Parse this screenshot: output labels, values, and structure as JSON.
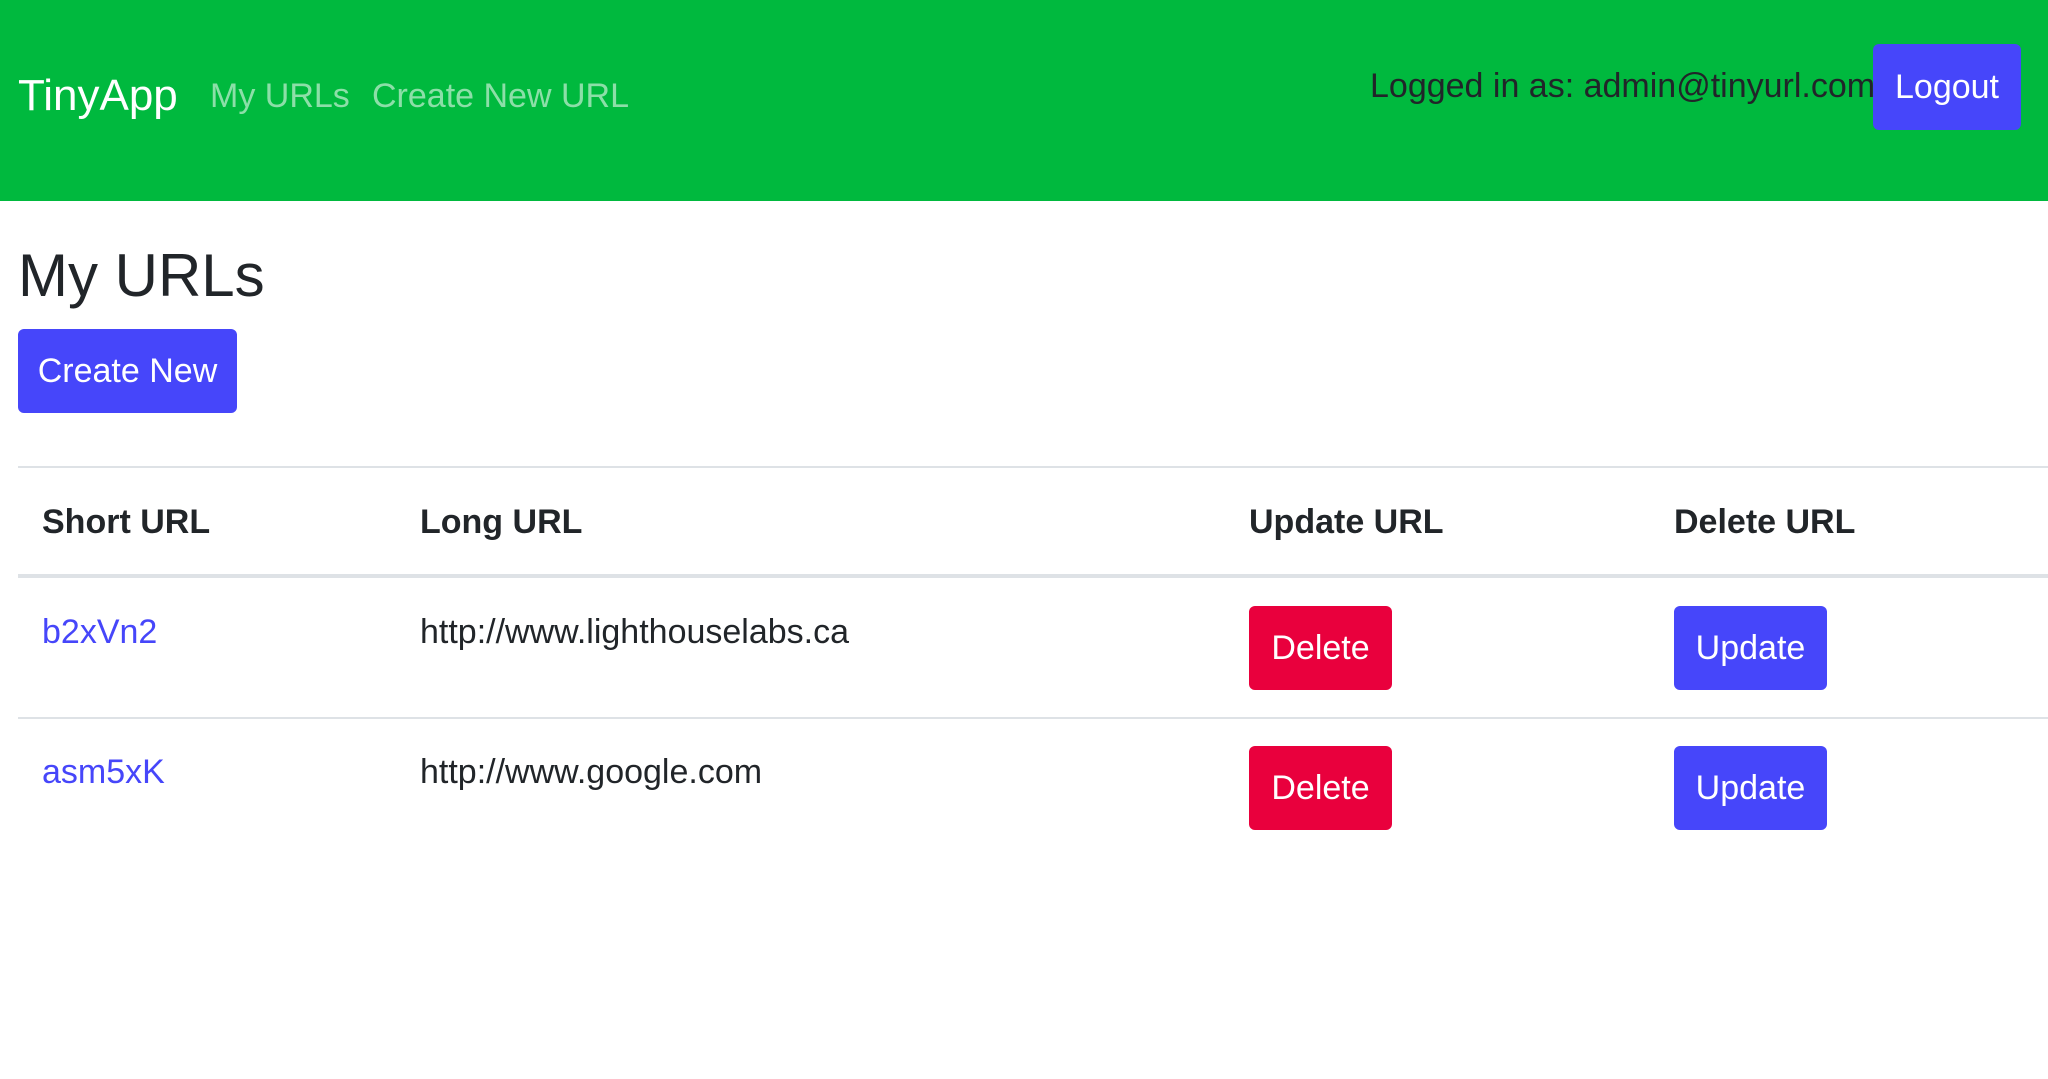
{
  "navbar": {
    "brand": "TinyApp",
    "links": [
      "My URLs",
      "Create New URL"
    ],
    "logged_in_text": "Logged in as: admin@tinyurl.com",
    "logout_label": "Logout"
  },
  "main": {
    "title": "My URLs",
    "create_button_label": "Create New"
  },
  "table": {
    "headers": [
      "Short URL",
      "Long URL",
      "Update URL",
      "Delete URL"
    ],
    "rows": [
      {
        "short_url": "b2xVn2",
        "long_url": "http://www.lighthouselabs.ca",
        "delete_label": "Delete",
        "update_label": "Update"
      },
      {
        "short_url": "asm5xK",
        "long_url": "http://www.google.com",
        "delete_label": "Delete",
        "update_label": "Update"
      }
    ]
  },
  "colors": {
    "navbar_bg": "#00b93e",
    "primary": "#4646fa",
    "danger": "#e9003d",
    "border": "#dee2e6"
  }
}
